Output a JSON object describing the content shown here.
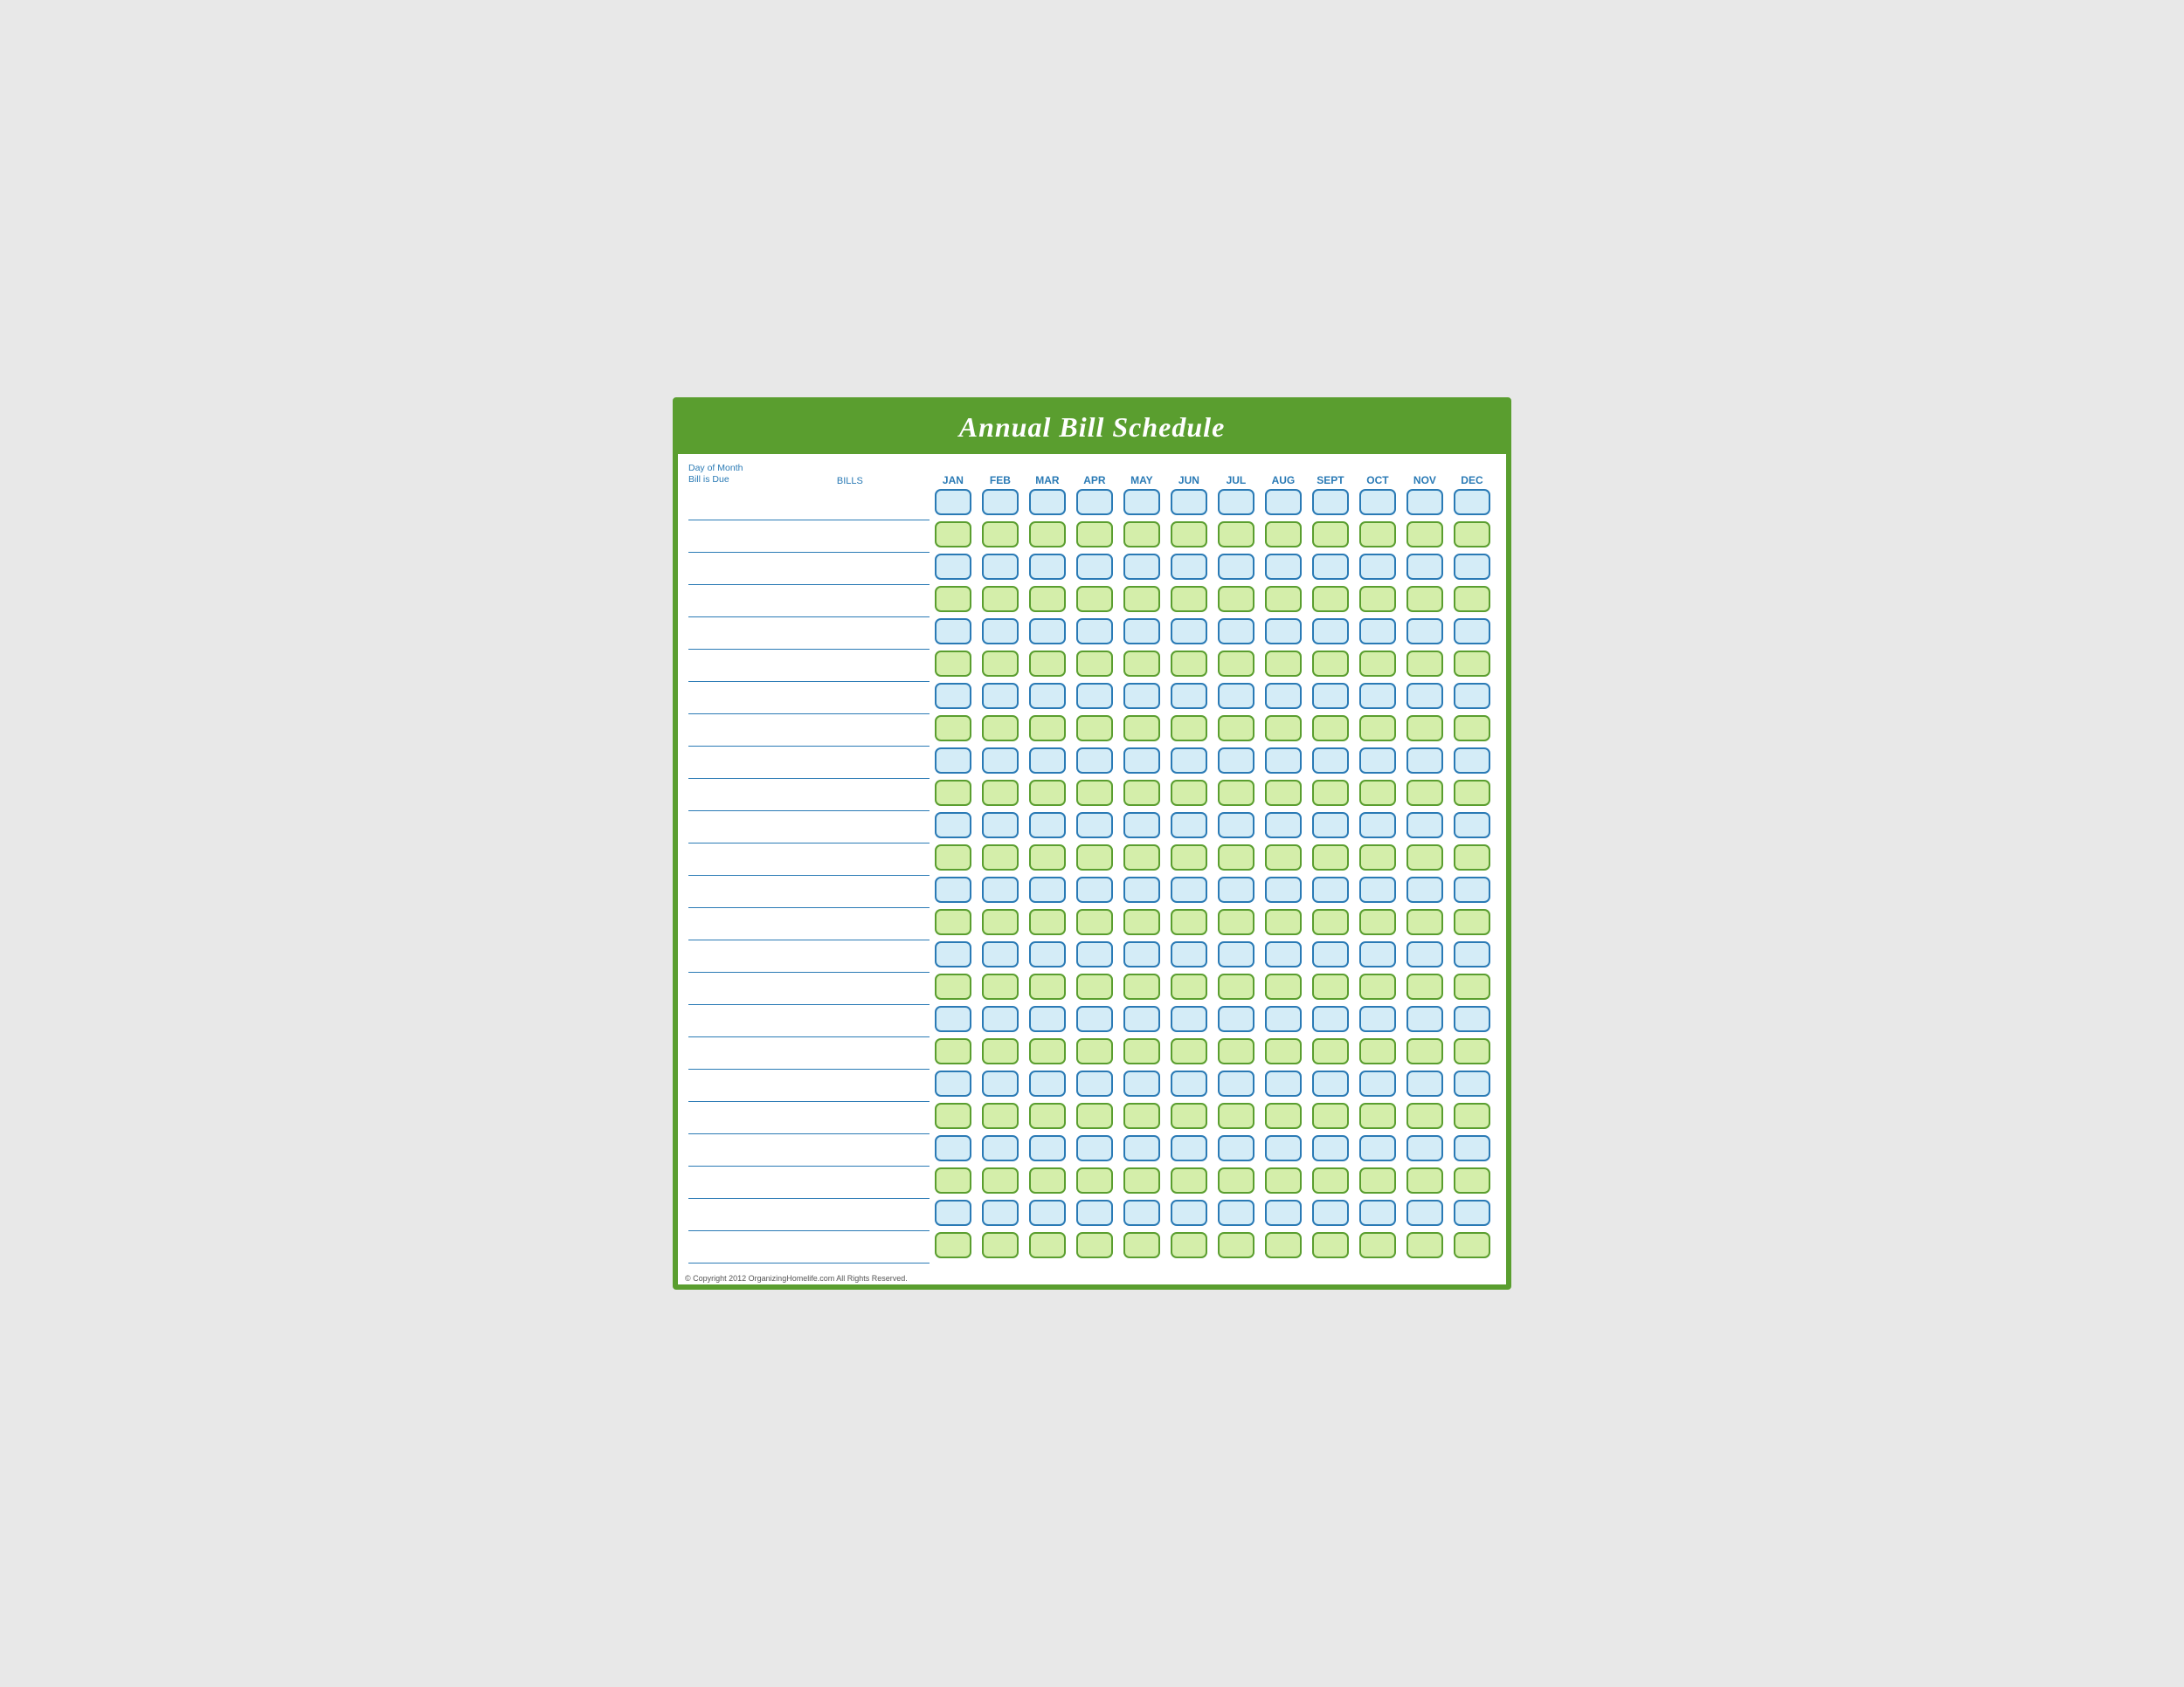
{
  "header": {
    "title": "Annual Bill Schedule"
  },
  "columns": {
    "day_label_line1": "Day of Month",
    "day_label_line2": "Bill is Due",
    "bills_label": "BILLS",
    "months": [
      "JAN",
      "FEB",
      "MAR",
      "APR",
      "MAY",
      "JUN",
      "JUL",
      "AUG",
      "SEPT",
      "OCT",
      "NOV",
      "DEC"
    ]
  },
  "rows": 24,
  "footer": {
    "copyright": "© Copyright 2012 OrganizingHomelife.com All Rights Reserved."
  }
}
